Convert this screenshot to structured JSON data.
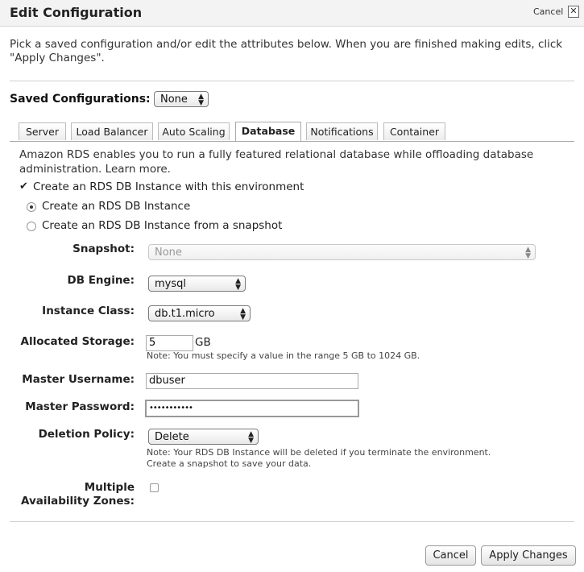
{
  "dialog": {
    "title": "Edit Configuration",
    "cancel_link": "Cancel",
    "close_glyph": "✕",
    "intro": "Pick a saved configuration and/or edit the attributes below. When you are finished making edits, click \"Apply Changes\"."
  },
  "saved_configurations": {
    "label": "Saved Configurations:",
    "value": "None"
  },
  "tabs": [
    {
      "label": "Server",
      "active": false
    },
    {
      "label": "Load Balancer",
      "active": false
    },
    {
      "label": "Auto Scaling",
      "active": false
    },
    {
      "label": "Database",
      "active": true
    },
    {
      "label": "Notifications",
      "active": false
    },
    {
      "label": "Container",
      "active": false
    }
  ],
  "database": {
    "description": "Amazon RDS enables you to run a fully featured relational database while offloading database administration.",
    "learn_more": "Learn more.",
    "create_checkbox": {
      "label": "Create an RDS DB Instance with this environment",
      "checked": true
    },
    "radio_new": {
      "label": "Create an RDS DB Instance",
      "selected": true
    },
    "radio_snapshot": {
      "label": "Create an RDS DB Instance from a snapshot",
      "selected": false
    },
    "snapshot": {
      "label": "Snapshot:",
      "value": "None"
    },
    "engine": {
      "label": "DB Engine:",
      "value": "mysql"
    },
    "instance_class": {
      "label": "Instance Class:",
      "value": "db.t1.micro"
    },
    "storage": {
      "label": "Allocated Storage:",
      "value": "5",
      "unit": "GB",
      "note": "Note: You must specify a value in the range 5 GB to 1024 GB."
    },
    "username": {
      "label": "Master Username:",
      "value": "dbuser"
    },
    "password": {
      "label": "Master Password:",
      "value": "•••••••••••"
    },
    "deletion_policy": {
      "label": "Deletion Policy:",
      "value": "Delete",
      "note_line1": "Note: Your RDS DB Instance will be deleted if you terminate the environment.",
      "note_line2": "Create a snapshot to save your data."
    },
    "multi_az": {
      "label_line1": "Multiple",
      "label_line2": "Availability Zones:",
      "checked": false
    }
  },
  "footer": {
    "cancel_label": "Cancel",
    "apply_label": "Apply Changes"
  }
}
